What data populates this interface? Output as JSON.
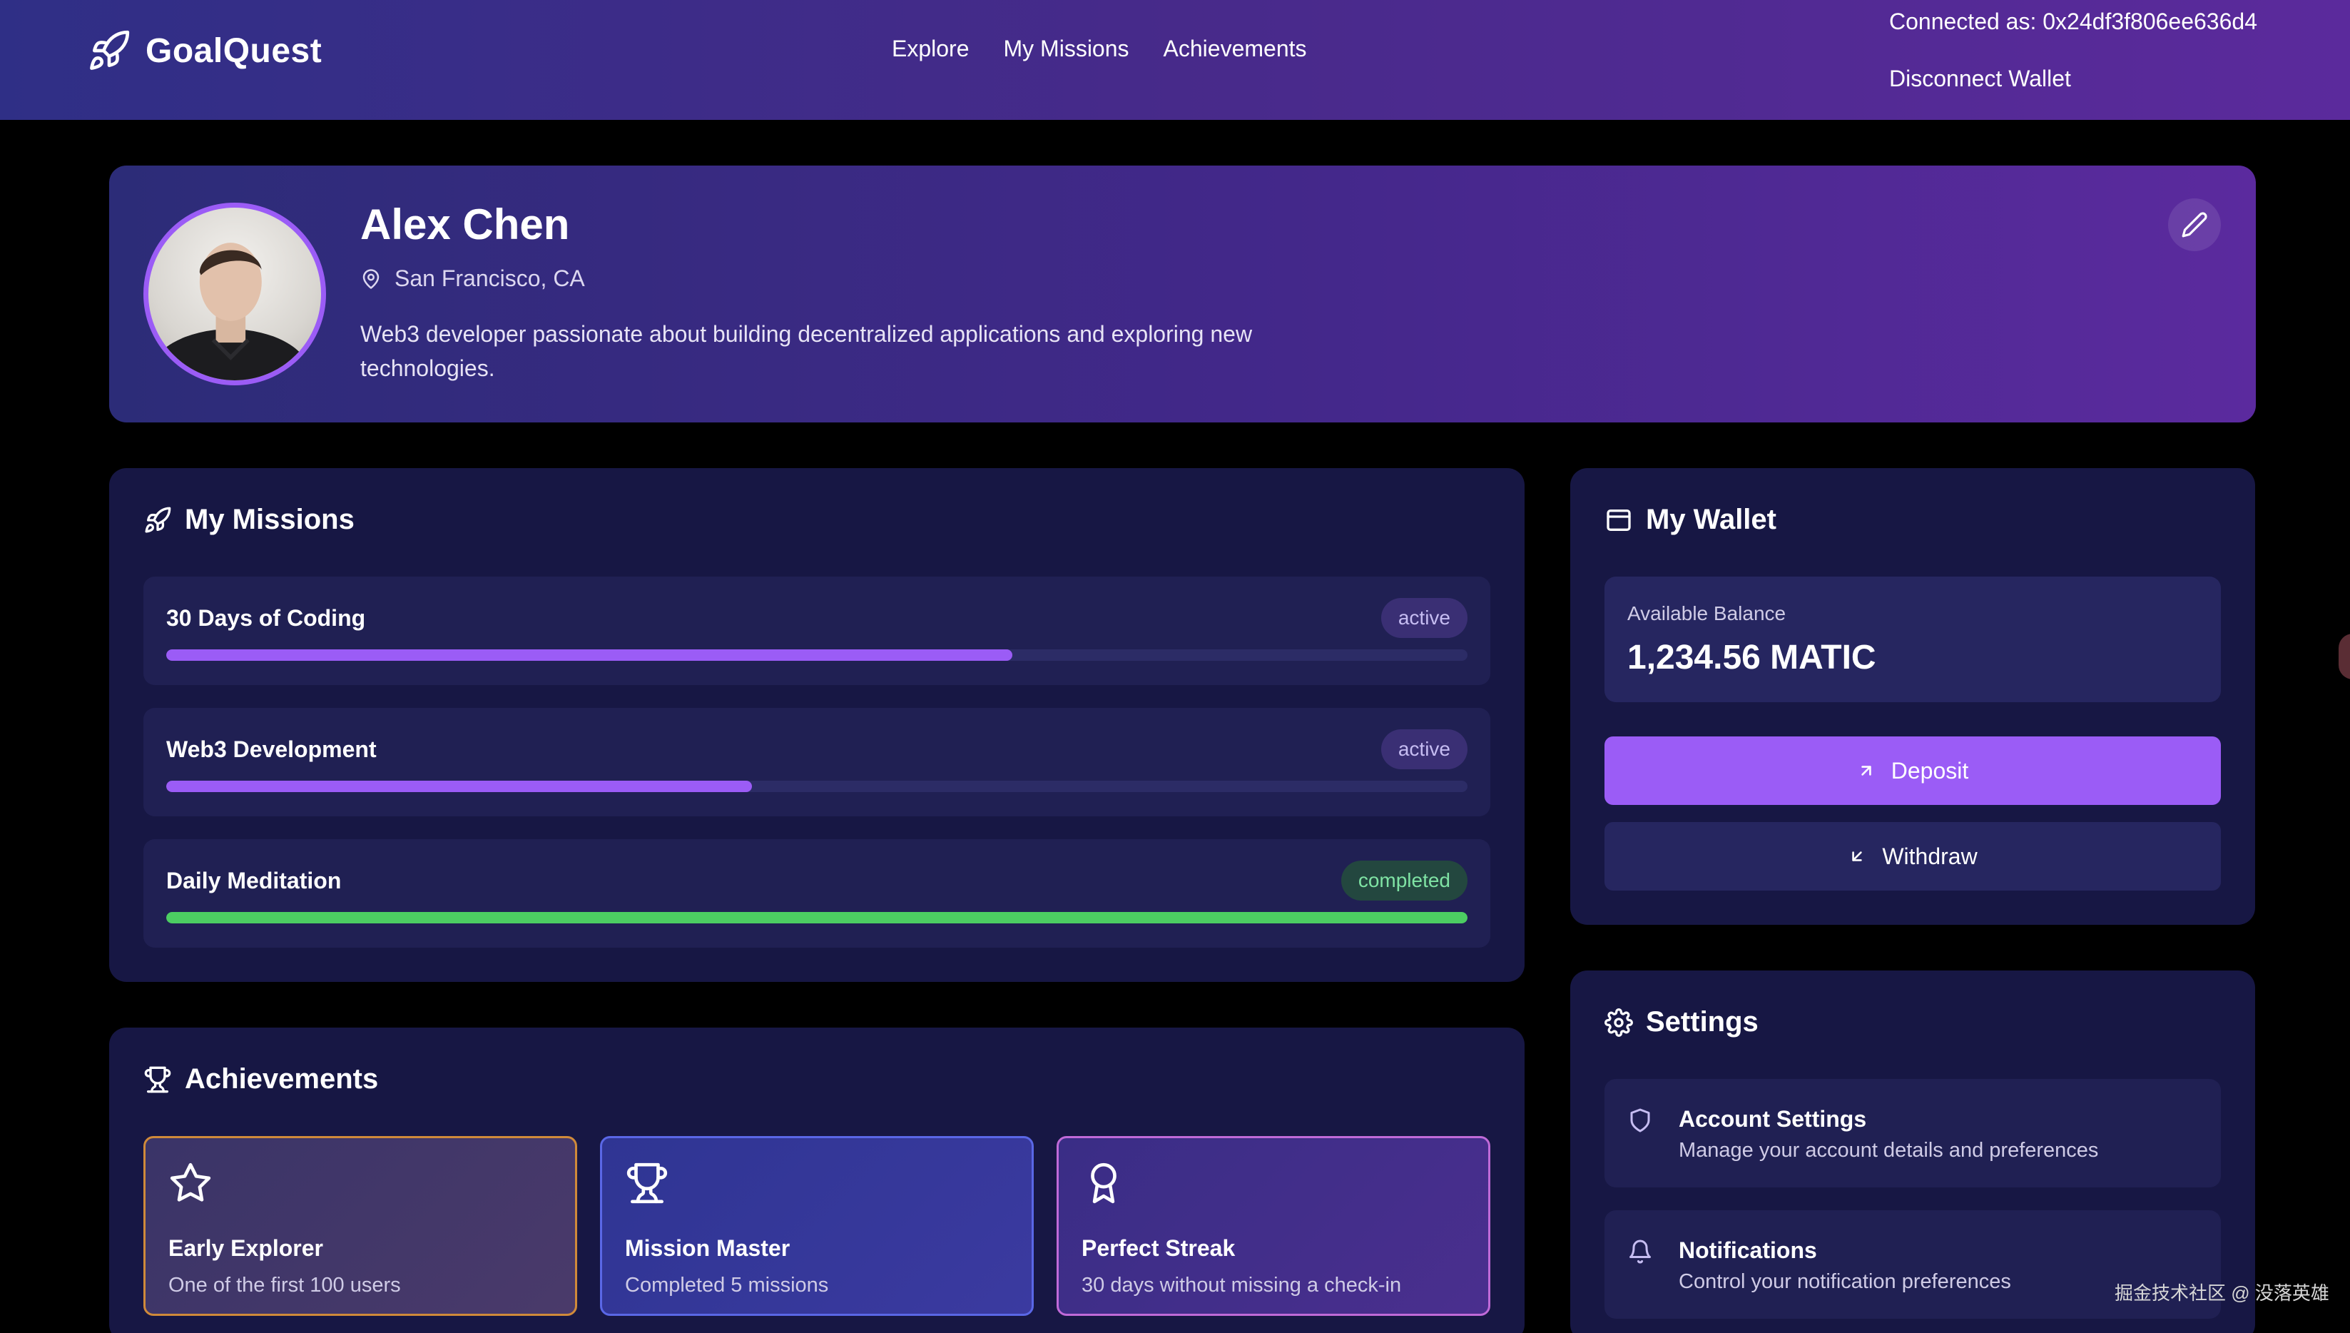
{
  "app": {
    "name": "GoalQuest"
  },
  "nav": {
    "items": [
      "Explore",
      "My Missions",
      "Achievements"
    ]
  },
  "wallet_status": {
    "connected_text": "Connected as: 0x24df3f806ee636d4",
    "disconnect_label": "Disconnect Wallet"
  },
  "profile": {
    "name": "Alex Chen",
    "location": "San Francisco, CA",
    "bio": "Web3 developer passionate about building decentralized applications and exploring new technologies."
  },
  "missions": {
    "title": "My Missions",
    "items": [
      {
        "name": "30 Days of Coding",
        "status": "active",
        "progress_pct": 65
      },
      {
        "name": "Web3 Development",
        "status": "active",
        "progress_pct": 45
      },
      {
        "name": "Daily Meditation",
        "status": "completed",
        "progress_pct": 100
      }
    ]
  },
  "achievements": {
    "title": "Achievements",
    "items": [
      {
        "title": "Early Explorer",
        "desc": "One of the first 100 users",
        "icon": "star-icon"
      },
      {
        "title": "Mission Master",
        "desc": "Completed 5 missions",
        "icon": "trophy-icon"
      },
      {
        "title": "Perfect Streak",
        "desc": "30 days without missing a check-in",
        "icon": "award-icon"
      }
    ]
  },
  "wallet": {
    "title": "My Wallet",
    "balance_label": "Available Balance",
    "balance_value": "1,234.56 MATIC",
    "deposit_label": "Deposit",
    "withdraw_label": "Withdraw"
  },
  "settings": {
    "title": "Settings",
    "items": [
      {
        "title": "Account Settings",
        "desc": "Manage your account details and preferences",
        "icon": "shield-icon"
      },
      {
        "title": "Notifications",
        "desc": "Control your notification preferences",
        "icon": "bell-icon"
      }
    ]
  },
  "watermark": "掘金技术社区 @ 没落英雄",
  "colors": {
    "accent": "#9b5cf6",
    "success": "#4ccd62",
    "panel": "#171744",
    "page_bg": "#000000"
  }
}
